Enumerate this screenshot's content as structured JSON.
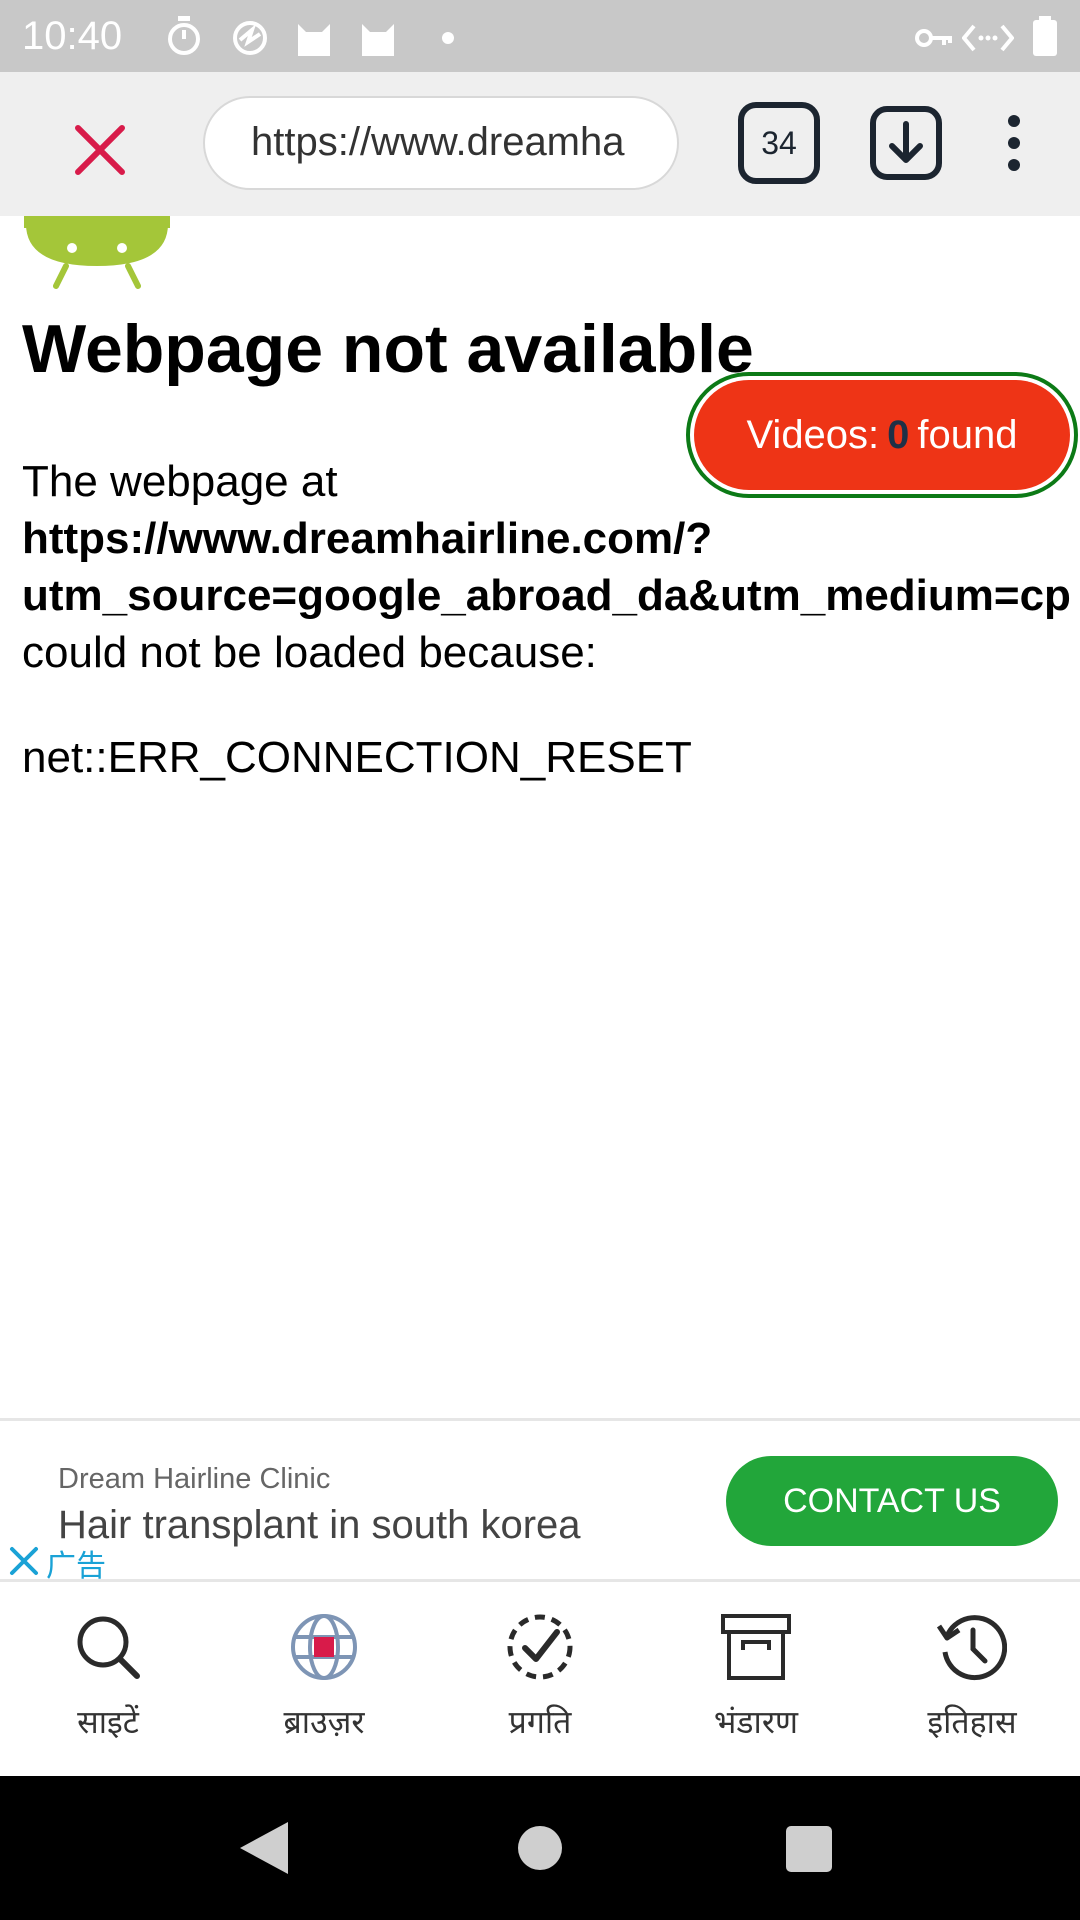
{
  "status_bar": {
    "time": "10:40"
  },
  "toolbar": {
    "url": "https://www.dreamha",
    "tab_count": "34"
  },
  "page": {
    "heading": "Webpage not available",
    "intro": "The webpage at",
    "url_line1": "https://www.dreamhairline.com/?",
    "url_line2": "utm_source=google_abroad_da&utm_medium=cp",
    "reason": "could not be loaded because:",
    "error_code": "net::ERR_CONNECTION_RESET"
  },
  "videos_badge": {
    "prefix": "Videos:",
    "count": "0",
    "suffix": "found"
  },
  "ad": {
    "advertiser": "Dream Hairline Clinic",
    "headline": "Hair transplant in south korea",
    "label": "广告",
    "cta": "CONTACT US"
  },
  "bottom_nav": [
    {
      "label": "साइटें",
      "icon": "search-icon"
    },
    {
      "label": "ब्राउज़र",
      "icon": "globe-icon"
    },
    {
      "label": "प्रगति",
      "icon": "progress-check-icon"
    },
    {
      "label": "भंडारण",
      "icon": "archive-icon"
    },
    {
      "label": "इतिहास",
      "icon": "history-icon"
    }
  ],
  "colors": {
    "close_icon": "#d81b4a",
    "videos_badge_bg": "#ee3416",
    "videos_badge_border": "#0c7a16",
    "cta_bg": "#22a63a",
    "ad_label": "#1aa2d6",
    "android_green": "#a4c639"
  }
}
